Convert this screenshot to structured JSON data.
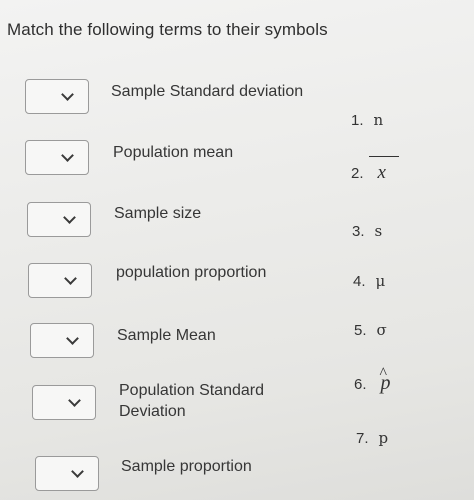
{
  "title": "Match the following terms to their symbols",
  "terms": [
    {
      "label": "Sample Standard deviation",
      "selected": ""
    },
    {
      "label": "Population mean",
      "selected": ""
    },
    {
      "label": "Sample size",
      "selected": ""
    },
    {
      "label": "population proportion",
      "selected": ""
    },
    {
      "label": "Sample Mean",
      "selected": ""
    },
    {
      "label": "Population Standard",
      "label2": "Deviation",
      "selected": ""
    },
    {
      "label": "Sample proportion",
      "selected": ""
    }
  ],
  "symbols": [
    {
      "number": "1.",
      "symbol": "n"
    },
    {
      "number": "2.",
      "symbol": "x"
    },
    {
      "number": "3.",
      "symbol": "s"
    },
    {
      "number": "4.",
      "symbol": "μ"
    },
    {
      "number": "5.",
      "symbol": "σ"
    },
    {
      "number": "6.",
      "symbol": "p"
    },
    {
      "number": "7.",
      "symbol": "p"
    }
  ],
  "icons": {
    "dropdown": "chevron-down-icon",
    "xbar_accent": "overline",
    "phat_accent": "circumflex"
  },
  "colors": {
    "text": "#333333",
    "box_border": "#9a9a9a",
    "box_fill": "#f7f7f6"
  }
}
